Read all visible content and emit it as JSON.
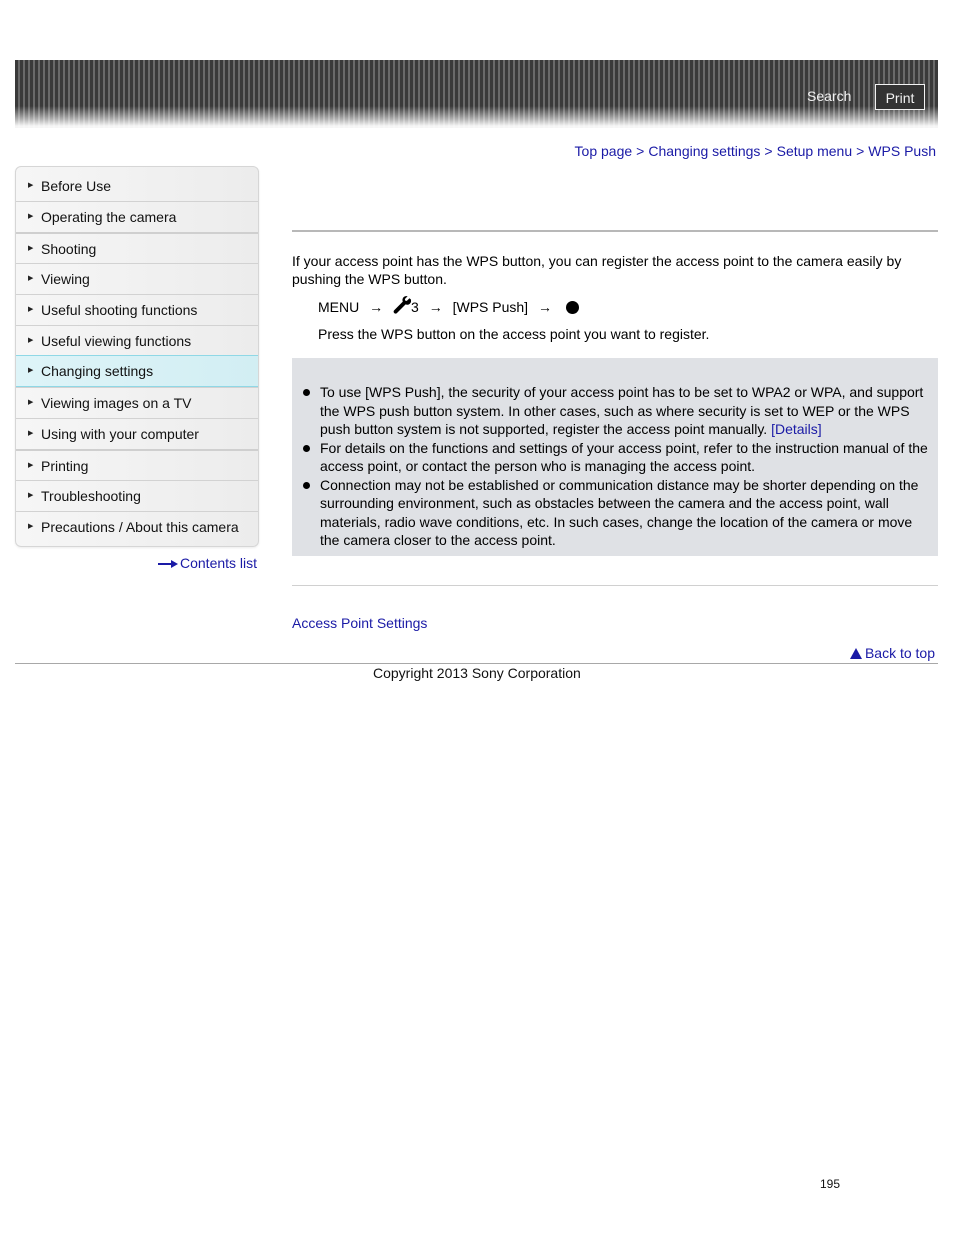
{
  "header": {
    "search_label": "Search",
    "print_label": "Print"
  },
  "breadcrumb": {
    "items": [
      "Top page",
      "Changing settings",
      "Setup menu",
      "WPS Push"
    ],
    "separator": ">"
  },
  "sidebar": {
    "items": [
      {
        "label": "Before Use",
        "active": false
      },
      {
        "label": "Operating the camera",
        "active": false
      },
      {
        "label": "Shooting",
        "active": false
      },
      {
        "label": "Viewing",
        "active": false
      },
      {
        "label": "Useful shooting functions",
        "active": false
      },
      {
        "label": "Useful viewing functions",
        "active": false
      },
      {
        "label": "Changing settings",
        "active": true
      },
      {
        "label": "Viewing images on a TV",
        "active": false
      },
      {
        "label": "Using with your computer",
        "active": false
      },
      {
        "label": "Printing",
        "active": false
      },
      {
        "label": "Troubleshooting",
        "active": false
      },
      {
        "label": "Precautions / About this camera",
        "active": false
      }
    ],
    "item_arrow_icon": "triangle-right-icon",
    "contents_list_label": "Contents list"
  },
  "main": {
    "intro": "If your access point has the WPS button, you can register the access point to the camera easily by pushing the WPS button.",
    "step1": {
      "menu": "MENU",
      "arrow": "→",
      "setup_icon": "wrench-icon",
      "setup_number": "3",
      "item": "[WPS Push]",
      "confirm_icon": "filled-circle-icon"
    },
    "step2": "Press the WPS button on the access point you want to register.",
    "notes": [
      {
        "text": "To use [WPS Push], the security of your access point has to be set to WPA2 or WPA, and support the WPS push button system. In other cases, such as where security is set to WEP or the WPS push button system is not supported, register the access point manually. ",
        "link": "[Details]"
      },
      {
        "text": "For details on the functions and settings of your access point, refer to the instruction manual of the access point, or contact the person who is managing the access point.",
        "link": null
      },
      {
        "text": "Connection may not be established or communication distance may be shorter depending on the surrounding environment, such as obstacles between the camera and the access point, wall materials, radio wave conditions, etc. In such cases, change the location of the camera or move the camera closer to the access point.",
        "link": null
      }
    ],
    "related_link": "Access Point Settings",
    "back_to_top": "Back to top"
  },
  "footer": {
    "copyright": "Copyright 2013 Sony Corporation",
    "page_number": "195"
  },
  "colors": {
    "link": "#1a1aa6",
    "note_background": "#dfe1e5",
    "active_item_background": "#d8f1f6",
    "active_item_border": "#8fd8e6"
  }
}
